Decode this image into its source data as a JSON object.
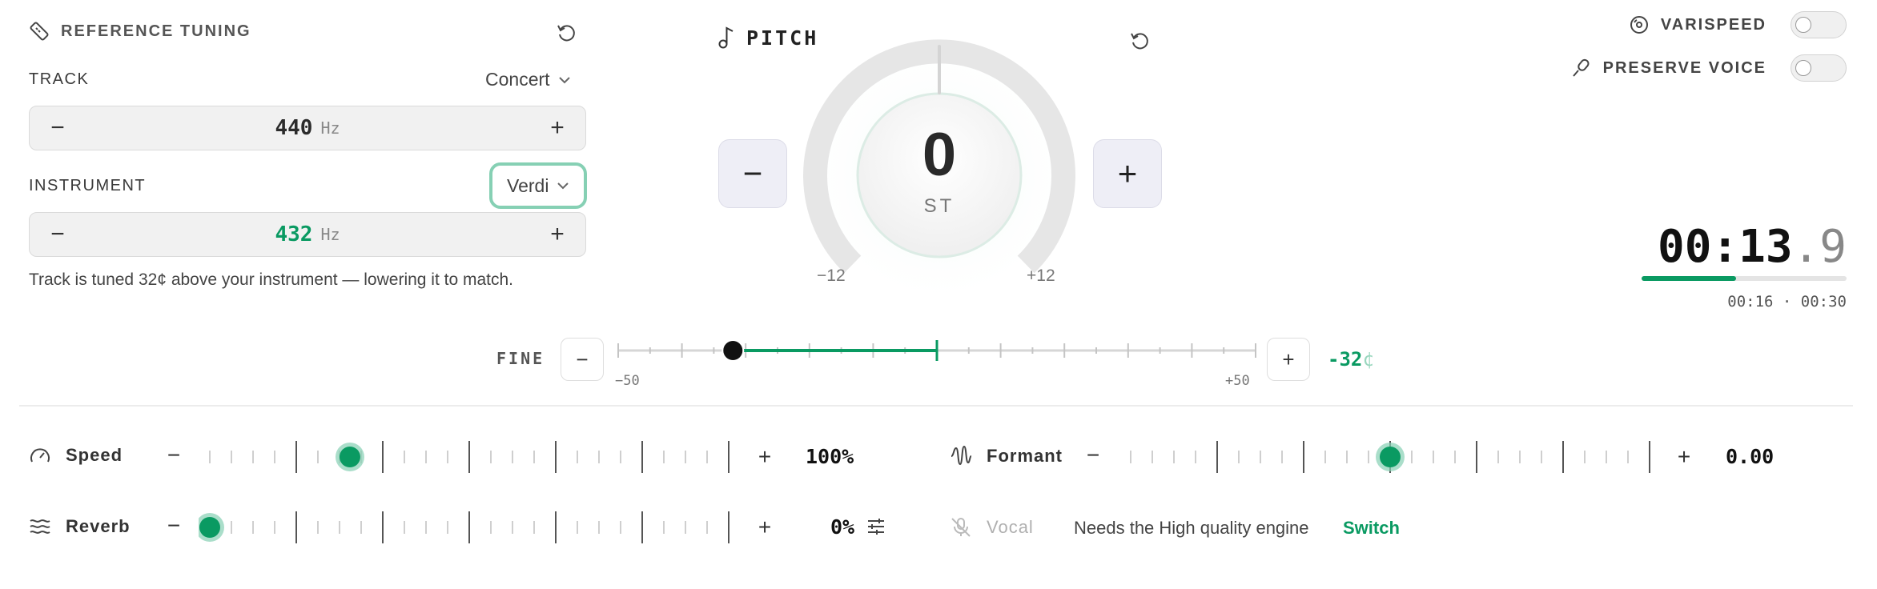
{
  "reference_tuning": {
    "title": "REFERENCE TUNING",
    "track_label": "TRACK",
    "track_preset": "Concert",
    "track_value": "440",
    "track_unit": "Hz",
    "instrument_label": "INSTRUMENT",
    "instrument_preset": "Verdi",
    "instrument_value": "432",
    "instrument_unit": "Hz",
    "info": "Track is tuned 32¢ above your instrument — lowering it to match."
  },
  "pitch": {
    "title": "PITCH",
    "value": "0",
    "unit": "ST",
    "min_label": "−12",
    "max_label": "+12",
    "minus": "−",
    "plus": "+"
  },
  "toggles": {
    "varispeed": {
      "label": "VARISPEED",
      "on": false
    },
    "preserve_voice": {
      "label": "PRESERVE VOICE",
      "on": false
    }
  },
  "timer": {
    "main": "00:13",
    "fraction": ".9",
    "progress": 0.46,
    "times": "00:16 · 00:30"
  },
  "fine": {
    "label": "FINE",
    "min_label": "−50",
    "max_label": "+50",
    "value_number": "-32",
    "value_unit": "¢",
    "min": -50,
    "max": 50,
    "value": -32
  },
  "speed": {
    "label": "Speed",
    "value": "100%",
    "level": 0.27
  },
  "formant": {
    "label": "Formant",
    "value": "0.00",
    "level": 0.5
  },
  "reverb": {
    "label": "Reverb",
    "value": "0%",
    "level": 0.0
  },
  "vocal": {
    "label": "Vocal",
    "message": "Needs the High quality engine",
    "action": "Switch"
  },
  "colors": {
    "accent": "#0a9a62",
    "accent_light": "#86d0b4"
  }
}
